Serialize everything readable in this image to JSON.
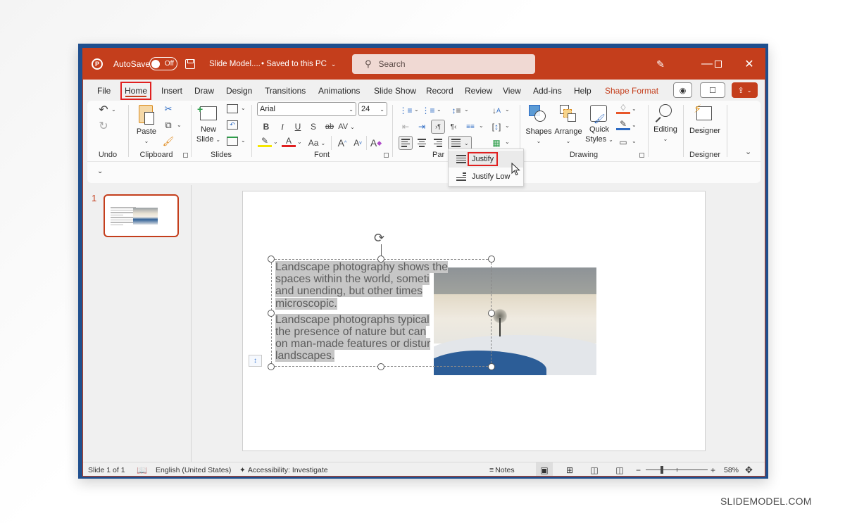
{
  "titlebar": {
    "autosave_label": "AutoSave",
    "autosave_state": "Off",
    "document_title": "Slide Model....",
    "save_status": "• Saved to this PC",
    "search_placeholder": "Search",
    "colors": {
      "titlebar_bg": "#c43e1c",
      "window_frame": "#1f4f8e"
    }
  },
  "menu": {
    "tabs": [
      {
        "label": "File"
      },
      {
        "label": "Home",
        "active": true
      },
      {
        "label": "Insert"
      },
      {
        "label": "Draw"
      },
      {
        "label": "Design"
      },
      {
        "label": "Transitions"
      },
      {
        "label": "Animations"
      },
      {
        "label": "Slide Show"
      },
      {
        "label": "Record"
      },
      {
        "label": "Review"
      },
      {
        "label": "View"
      },
      {
        "label": "Add-ins"
      },
      {
        "label": "Help"
      },
      {
        "label": "Shape Format"
      }
    ]
  },
  "ribbon": {
    "groups": {
      "undo": "Undo",
      "clipboard": "Clipboard",
      "slides": "Slides",
      "font": "Font",
      "paragraph": "Par",
      "drawing": "Drawing",
      "designer": "Designer"
    },
    "paste_label": "Paste",
    "new_slide_label_1": "New",
    "new_slide_label_2": "Slide",
    "font_name": "Arial",
    "font_size": "24",
    "bold": "B",
    "italic": "I",
    "underline": "U",
    "shadow": "S",
    "strike": "ab",
    "spacing": "AV",
    "case": "Aa",
    "grow": "A",
    "shrink": "A",
    "clear": "A",
    "shapes_label": "Shapes",
    "arrange_label": "Arrange",
    "quick_styles_label_1": "Quick",
    "quick_styles_label_2": "Styles",
    "editing_label": "Editing",
    "designer_label": "Designer"
  },
  "align_dropdown": {
    "items": [
      {
        "label": "Justify",
        "highlighted": true
      },
      {
        "label": "Justify Low"
      }
    ]
  },
  "thumbnails": [
    {
      "number": "1",
      "selected": true
    }
  ],
  "slide": {
    "paragraphs": [
      [
        "Landscape photography shows the",
        "spaces within the world, someti",
        "and unending, but other times",
        "microscopic."
      ],
      [
        "Landscape photographs typical",
        "the presence of nature but can",
        "on man-made features or distur",
        "landscapes."
      ]
    ]
  },
  "statusbar": {
    "slide_counter": "Slide 1 of 1",
    "language": "English (United States)",
    "accessibility": "Accessibility: Investigate",
    "notes_label": "Notes",
    "zoom_percent": "58%",
    "zoom_value": 58
  },
  "watermark": "SLIDEMODEL.COM"
}
